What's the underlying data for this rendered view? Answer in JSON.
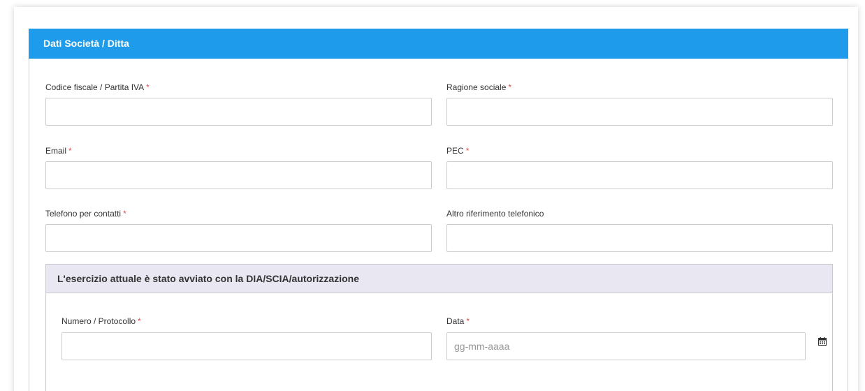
{
  "section": {
    "title": "Dati Società / Ditta"
  },
  "required_marker": "*",
  "fields": {
    "codice_fiscale": {
      "label": "Codice fiscale / Partita IVA",
      "value": ""
    },
    "ragione_sociale": {
      "label": "Ragione sociale",
      "value": ""
    },
    "email": {
      "label": "Email",
      "value": ""
    },
    "pec": {
      "label": "PEC",
      "value": ""
    },
    "telefono": {
      "label": "Telefono per contatti",
      "value": ""
    },
    "altro_telefono": {
      "label": "Altro riferimento telefonico",
      "value": ""
    }
  },
  "subsection": {
    "title": "L'esercizio attuale è stato avviato con la DIA/SCIA/autorizzazione",
    "numero": {
      "label": "Numero / Protocollo",
      "value": ""
    },
    "data": {
      "label": "Data",
      "value": "",
      "placeholder": "gg-mm-aaaa",
      "icon": "calendar-icon"
    }
  },
  "colors": {
    "header_bg": "#1e9bea",
    "subheader_bg": "#e9e7f2",
    "required": "#d9534f"
  }
}
